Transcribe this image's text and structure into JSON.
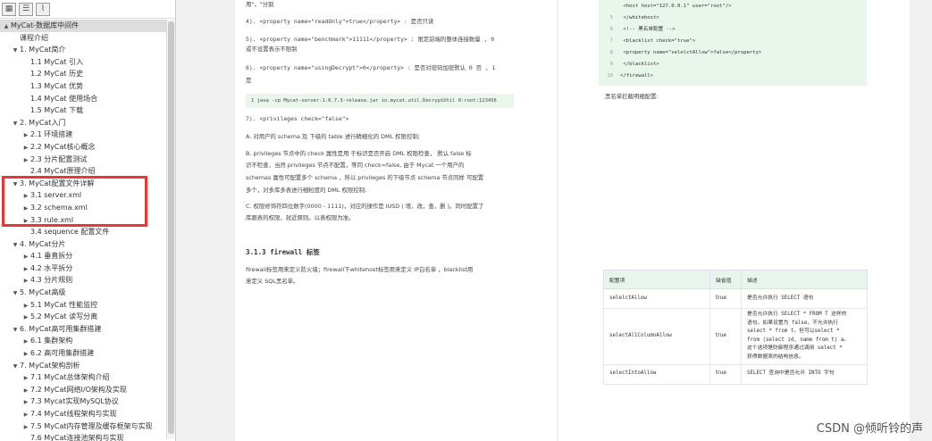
{
  "toolbar": {
    "icons": [
      "outline-icon",
      "list-icon",
      "attachment-icon"
    ]
  },
  "tree": [
    {
      "label": "MyCat-数据库中间件",
      "level": 0,
      "arrow": "▲",
      "selected": true
    },
    {
      "label": "课程介绍",
      "level": 1,
      "arrow": ""
    },
    {
      "label": "1. MyCat简介",
      "level": 1,
      "arrow": "▼"
    },
    {
      "label": "1.1 MyCat 引入",
      "level": 2,
      "arrow": ""
    },
    {
      "label": "1.2 MyCat 历史",
      "level": 2,
      "arrow": ""
    },
    {
      "label": "1.3 MyCat 优势",
      "level": 2,
      "arrow": ""
    },
    {
      "label": "1.4 MyCat 使用场合",
      "level": 2,
      "arrow": ""
    },
    {
      "label": "1.5 MyCat 下载",
      "level": 2,
      "arrow": ""
    },
    {
      "label": "2. MyCat入门",
      "level": 1,
      "arrow": "▼"
    },
    {
      "label": "2.1 环境搭建",
      "level": 2,
      "arrow": "▶"
    },
    {
      "label": "2.2 MyCat核心概念",
      "level": 2,
      "arrow": "▶"
    },
    {
      "label": "2.3 分片配置测试",
      "level": 2,
      "arrow": "▶"
    },
    {
      "label": "2.4 MyCat原理介绍",
      "level": 2,
      "arrow": ""
    },
    {
      "label": "3. MyCat配置文件详解",
      "level": 1,
      "arrow": "▼"
    },
    {
      "label": "3.1 server.xml",
      "level": 2,
      "arrow": "▶"
    },
    {
      "label": "3.2 schema.xml",
      "level": 2,
      "arrow": "▶"
    },
    {
      "label": "3.3 rule.xml",
      "level": 2,
      "arrow": "▶"
    },
    {
      "label": "3.4 sequence 配置文件",
      "level": 2,
      "arrow": ""
    },
    {
      "label": "4. MyCat分片",
      "level": 1,
      "arrow": "▼"
    },
    {
      "label": "4.1 垂直拆分",
      "level": 2,
      "arrow": "▶"
    },
    {
      "label": "4.2 水平拆分",
      "level": 2,
      "arrow": "▶"
    },
    {
      "label": "4.3 分片规则",
      "level": 2,
      "arrow": "▶"
    },
    {
      "label": "5. MyCat高级",
      "level": 1,
      "arrow": "▼"
    },
    {
      "label": "5.1 MyCat 性能监控",
      "level": 2,
      "arrow": "▶"
    },
    {
      "label": "5.2 MyCat 读写分离",
      "level": 2,
      "arrow": "▶"
    },
    {
      "label": "6. MyCat高可用集群搭建",
      "level": 1,
      "arrow": "▼"
    },
    {
      "label": "6.1 集群架构",
      "level": 2,
      "arrow": "▶"
    },
    {
      "label": "6.2 高可用集群搭建",
      "level": 2,
      "arrow": "▶"
    },
    {
      "label": "7. MyCat架构剖析",
      "level": 1,
      "arrow": "▼"
    },
    {
      "label": "7.1 MyCat总体架构介绍",
      "level": 2,
      "arrow": "▶"
    },
    {
      "label": "7.2 MyCat网络I/O架构及实现",
      "level": 2,
      "arrow": "▶"
    },
    {
      "label": "7.3 Mycat实现MySQL协议",
      "level": 2,
      "arrow": "▶"
    },
    {
      "label": "7.4 MyCat线程架构与实现",
      "level": 2,
      "arrow": "▶"
    },
    {
      "label": "7.5 MyCat内存管理及缓存框架与实现",
      "level": 2,
      "arrow": "▶"
    },
    {
      "label": "7.6 MyCat连接池架构与实现",
      "level": 2,
      "arrow": ""
    }
  ],
  "page1": {
    "l1": "用\"，\"分割",
    "l2": "4). <property name=\"readOnly\">true</property> : 是否只读",
    "l3": "5). <property name=\"benchmark\">11111</property> : 限定前端的整体连接数量 , 0",
    "l3b": "或不设置表示不限制",
    "l4": "6). <property name=\"usingDecrypt\">0</property> : 是否对密码加密默认 0 否 , 1",
    "l4b": "是",
    "code": "1    java -cp Mycat-server-1.6.7.3-release.jar io.mycat.util.DecryptUtil 0:root:123456",
    "l5": "7). <privileges check=\"false\">",
    "a": "A. 对用户的 schema 及 下级的 table 进行精细化的 DML 权限控制;",
    "b1": "B. privileges 节点中的 check 属性是用 于标识是否开启 DML 权限检查， 默认 false 标",
    "b2": "识不检查，当然 privileges 节点不配置，等同 check=false, 由于 Mycat 一个用户的",
    "b3": "schemas 属性可配置多个 schema ，所以 privileges 的下级节点 schema 节点同样 可配置",
    "b4": "多个，对多库多表进行细粒度的 DML 权限控制;",
    "c1": "C. 权限修饰符四位数字(0000 - 1111)，对应的操作是 IUSD ( 增，改，查，删 )。同时配置了",
    "c2": "库跟表的权限，就近原则。以表权限为准。",
    "h3": "3.1.3 firewall 标签",
    "f1": "firewall标签用来定义防火墙；firewall下whitehost标签用来定义 IP白名单 ，blacklist用",
    "f2": "来定义 SQL黑名单。"
  },
  "page2": {
    "code": [
      {
        "n": "",
        "t": "    <host host=\"127.0.0.1\" user=\"root\"/>"
      },
      {
        "n": "5",
        "t": "    </whitehost>"
      },
      {
        "n": "6",
        "t": "    <!-- 黑名单配置 -->"
      },
      {
        "n": "7",
        "t": "    <blacklist check=\"true\">"
      },
      {
        "n": "8",
        "t": "        <property name=\"selelctAllow\">false</property>"
      },
      {
        "n": "9",
        "t": "    </blacklist>"
      },
      {
        "n": "10",
        "t": "</firewall>"
      }
    ],
    "caption": "黑名单拦截明细配置:",
    "table": {
      "headers": [
        "配置项",
        "缺省值",
        "描述"
      ],
      "rows": [
        {
          "k": "selelctAllow",
          "v": "true",
          "d": [
            "是否允许执行 SELECT 语句"
          ]
        },
        {
          "k": "selectAllColumnAllow",
          "v": "true",
          "d": [
            "是否允许执行 SELECT * FROM T 这样的",
            "语句。如果设置为 false，不允许执行",
            "select * from t，但可以select *",
            "from (select id, name from t) a。",
            "这个选项是防御程序通过调用 select *",
            "获得数据表的结构信息。"
          ]
        },
        {
          "k": "selectIntoAllow",
          "v": "true",
          "d": [
            "SELECT 查询中是否允许 INTO 字句"
          ]
        }
      ]
    }
  },
  "watermark": "CSDN @倾听铃的声"
}
